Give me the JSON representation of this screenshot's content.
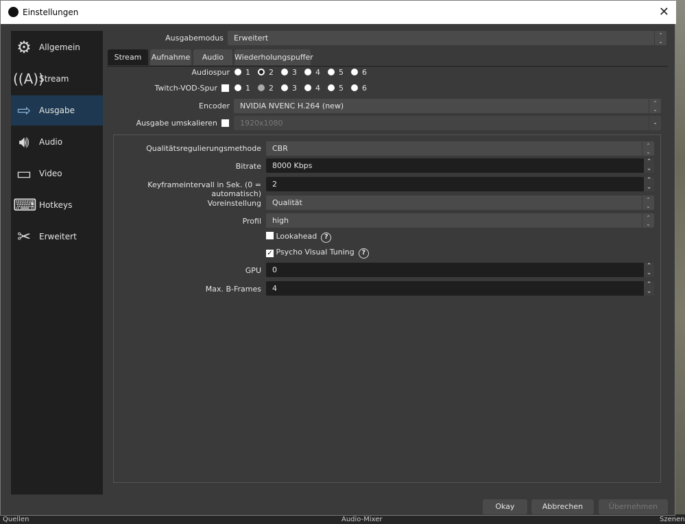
{
  "window": {
    "title": "Einstellungen",
    "close": "✕"
  },
  "sidebar": {
    "items": [
      {
        "label": "Allgemein",
        "icon": "gear-icon"
      },
      {
        "label": "Stream",
        "icon": "antenna-icon"
      },
      {
        "label": "Ausgabe",
        "icon": "monitor-output-icon",
        "selected": true
      },
      {
        "label": "Audio",
        "icon": "speaker-icon"
      },
      {
        "label": "Video",
        "icon": "monitor-icon"
      },
      {
        "label": "Hotkeys",
        "icon": "keyboard-icon"
      },
      {
        "label": "Erweitert",
        "icon": "tools-icon"
      }
    ]
  },
  "output_mode": {
    "label": "Ausgabemodus",
    "value": "Erweitert"
  },
  "tabs": [
    "Stream",
    "Aufnahme",
    "Audio",
    "Wiederholungspuffer"
  ],
  "active_tab": "Stream",
  "audio_track": {
    "label": "Audiospur",
    "options": [
      "1",
      "2",
      "3",
      "4",
      "5",
      "6"
    ],
    "selected": "2"
  },
  "twitch_vod": {
    "label": "Twitch-VOD-Spur",
    "checked": false,
    "options": [
      "1",
      "2",
      "3",
      "4",
      "5",
      "6"
    ],
    "selected": "2"
  },
  "encoder": {
    "label": "Encoder",
    "value": "NVIDIA NVENC H.264 (new)"
  },
  "rescale": {
    "label": "Ausgabe umskalieren",
    "checked": false,
    "value": "1920x1080"
  },
  "settings": {
    "rate_control": {
      "label": "Qualitätsregulierungsmethode",
      "value": "CBR"
    },
    "bitrate": {
      "label": "Bitrate",
      "value": "8000 Kbps"
    },
    "keyframe": {
      "label": "Keyframeintervall in Sek. (0 = automatisch)",
      "value": "2"
    },
    "preset": {
      "label": "Voreinstellung",
      "value": "Qualität"
    },
    "profile": {
      "label": "Profil",
      "value": "high"
    },
    "lookahead": {
      "label": "Lookahead",
      "checked": false
    },
    "psycho": {
      "label": "Psycho Visual Tuning",
      "checked": true
    },
    "gpu": {
      "label": "GPU",
      "value": "0"
    },
    "bframes": {
      "label": "Max. B-Frames",
      "value": "4"
    }
  },
  "buttons": {
    "ok": "Okay",
    "cancel": "Abbrechen",
    "apply": "Übernehmen"
  },
  "background": {
    "sources": "Quellen",
    "mixer": "Audio-Mixer",
    "scenes": "Szenen"
  }
}
